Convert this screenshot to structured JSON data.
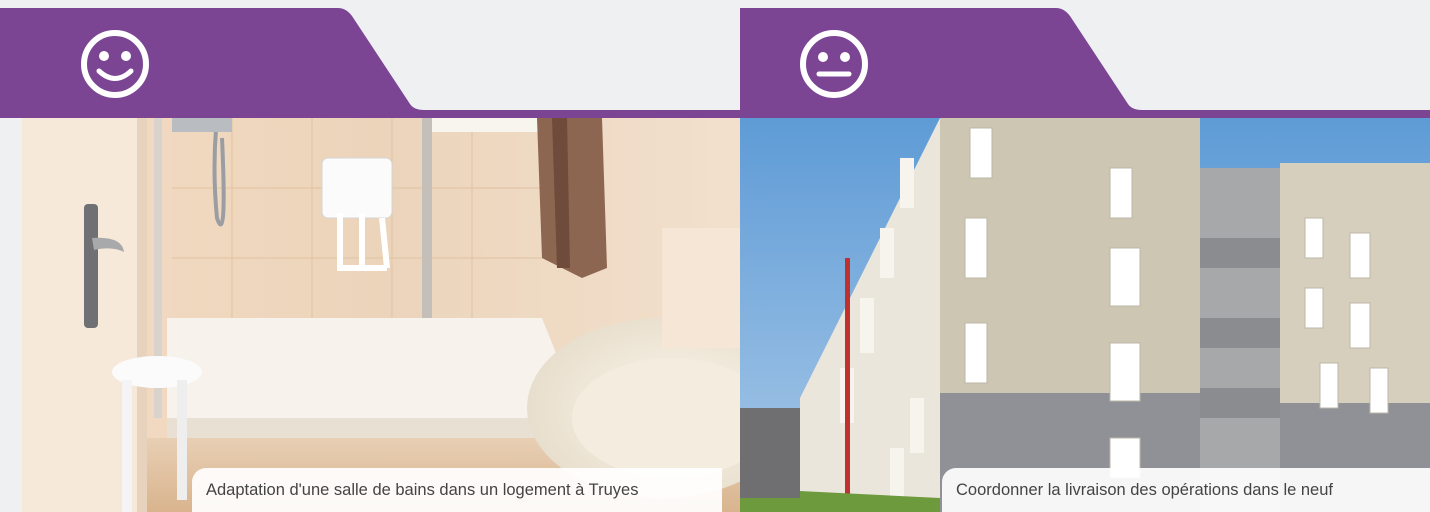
{
  "colors": {
    "accent": "#7b4594",
    "background": "#eef0f2"
  },
  "cards": [
    {
      "icon": "smiling-face-icon",
      "photo": "bathroom-shower-photo",
      "caption": "Adaptation d'une salle de bains dans un logement à Truyes"
    },
    {
      "icon": "neutral-face-icon",
      "photo": "apartment-building-photo",
      "caption": "Coordonner la livraison des opérations dans le neuf"
    }
  ]
}
